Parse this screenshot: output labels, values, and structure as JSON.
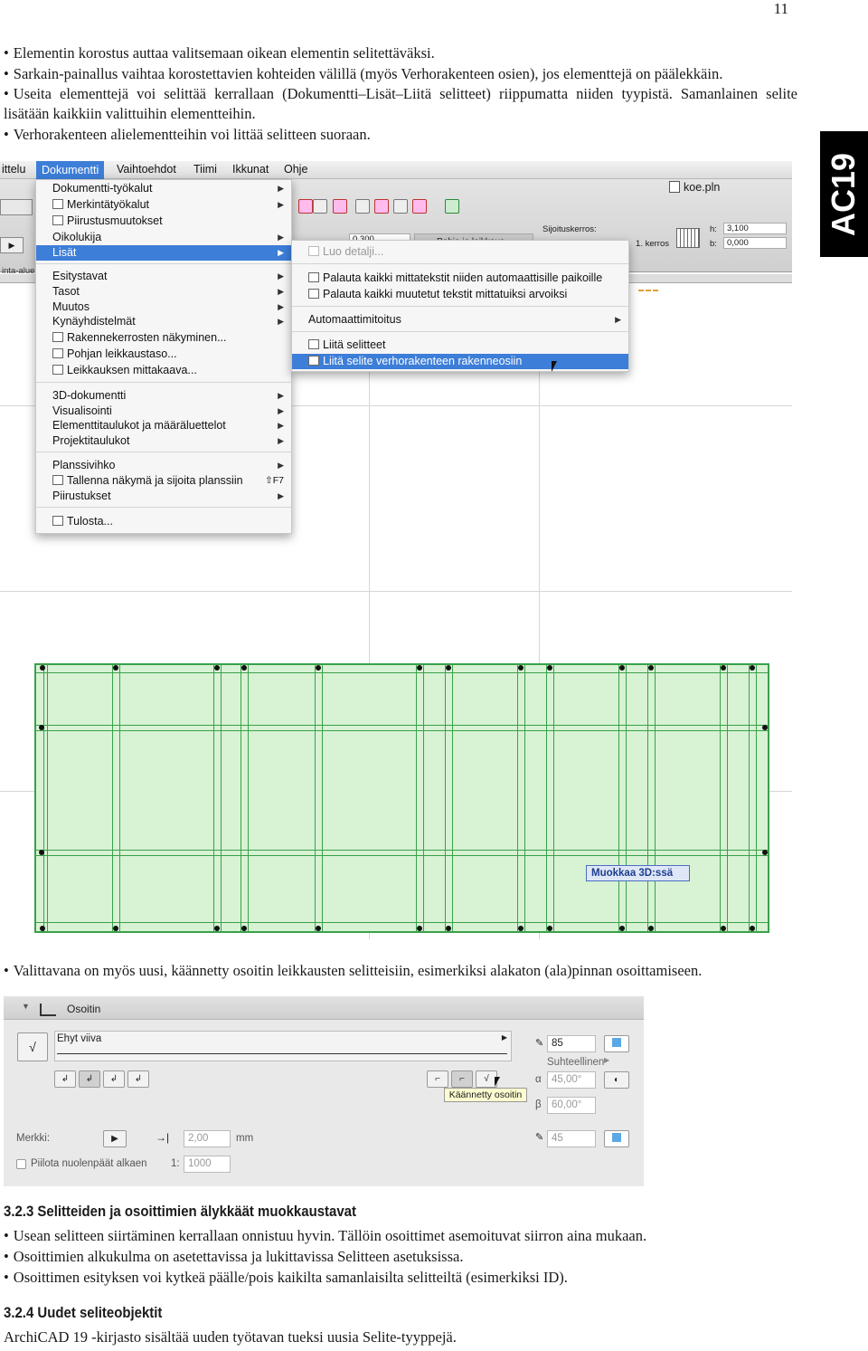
{
  "page_number": "11",
  "side_tab": "AC19",
  "bullets_top": [
    "Elementin korostus auttaa valitsemaan oikean elementin selitettäväksi.",
    "Sarkain-painallus vaihtaa korostettavien kohteiden välillä (myös Verhorakenteen osien), jos elementtejä on päälekkäin.",
    "Useita elementtejä voi selittää kerrallaan (Dokumentti–Lisät–Liitä selitteet) riippumatta niiden tyypistä. Samanlainen selite lisätään kaikkiin valittuihin elementteihin.",
    "Verhorakenteen alielementteihin voi littää selitteen suoraan."
  ],
  "menubar": [
    "ittelu",
    "Dokumentti",
    "Vaihtoehdot",
    "Tiimi",
    "Ikkunat",
    "Ohje"
  ],
  "window_title": "koe.pln",
  "toolbar": {
    "placement_label": "Sijoituskerros:",
    "story_value": "1. kerros",
    "h_label": "h:",
    "h_value": "3,100",
    "b_label": "b:",
    "b_value": "0,000",
    "field_value": "0,300",
    "tab_label": "Pohja ja leikkaus",
    "left_label": "inta-alue"
  },
  "menu_dokumentti": [
    {
      "label": "Dokumentti-työkalut",
      "arrow": true
    },
    {
      "label": "Merkintätyökalut",
      "arrow": true,
      "icon": true
    },
    {
      "label": "Piirustusmuutokset",
      "icon": true
    },
    {
      "label": "Oikolukija",
      "arrow": true
    },
    {
      "label": "Lisät",
      "arrow": true,
      "selected": true
    },
    {
      "label": "Esitystavat",
      "arrow": true
    },
    {
      "label": "Tasot",
      "arrow": true
    },
    {
      "label": "Muutos",
      "arrow": true
    },
    {
      "label": "Kynäyhdistelmät",
      "arrow": true
    },
    {
      "label": "Rakennekerrosten näkyminen...",
      "icon": true
    },
    {
      "label": "Pohjan leikkaustaso...",
      "icon": true
    },
    {
      "label": "Leikkauksen mittakaava...",
      "icon": true
    },
    {
      "label": "3D-dokumentti",
      "arrow": true
    },
    {
      "label": "Visualisointi",
      "arrow": true
    },
    {
      "label": "Elementtitaulukot ja määräluettelot",
      "arrow": true
    },
    {
      "label": "Projektitaulukot",
      "arrow": true
    },
    {
      "label": "Planssivihko",
      "arrow": true
    },
    {
      "label": "Tallenna näkymä ja sijoita planssiin",
      "shortcut": "⇧F7",
      "icon": true
    },
    {
      "label": "Piirustukset",
      "arrow": true
    },
    {
      "label": "Tulosta...",
      "icon": true
    }
  ],
  "menu_lisat": [
    {
      "label": "Luo detalji...",
      "disabled": true,
      "icon": true
    },
    {
      "label": "Palauta kaikki mittatekstit niiden automaattisille paikoille",
      "icon": true
    },
    {
      "label": "Palauta kaikki muutetut tekstit mittatuiksi arvoiksi",
      "icon": true
    },
    {
      "label": "Automaattimitoitus",
      "arrow": true
    },
    {
      "label": "Liitä selitteet",
      "icon": true
    },
    {
      "label": "Liitä selite verhorakenteen rakenneosiin",
      "icon": true,
      "selected": true
    }
  ],
  "curtain_wall_tag": "Muokkaa 3D:ssä",
  "bullet_middle": "Valittavana on myös uusi, käännetty osoitin leikkausten selitteisiin, esimerkiksi alakaton (ala)pinnan osoittamiseen.",
  "panel": {
    "title": "Osoitin",
    "line_type": "Ehyt viiva",
    "pen_value": "85",
    "proportional": "Suhteellinen",
    "alpha_label": "α",
    "alpha_value": "45,00°",
    "beta_label": "β",
    "beta_value": "60,00°",
    "tooltip": "Käännetty osoitin",
    "marker_label": "Merkki:",
    "size_value": "2,00",
    "size_unit": "mm",
    "pen2_value": "45",
    "hide_label": "Piilota nuolenpäät alkaen",
    "scale_prefix": "1:",
    "scale_value": "1000"
  },
  "section_323": {
    "heading": "3.2.3 Selitteiden ja osoittimien älykkäät muokkaustavat",
    "bullets": [
      "Usean selitteen siirtäminen kerrallaan onnistuu hyvin. Tällöin osoittimet asemoituvat siirron aina mukaan.",
      "Osoittimien alkukulma on asetettavissa ja lukittavissa Selitteen asetuksissa.",
      "Osoittimen esityksen voi kytkeä päälle/pois kaikilta samanlaisilta selitteiltä (esimerkiksi ID)."
    ]
  },
  "section_324": {
    "heading": "3.2.4 Uudet seliteobjektit",
    "text": "ArchiCAD 19 -kirjasto sisältää uuden työtavan tueksi uusia Selite-tyyppejä."
  }
}
